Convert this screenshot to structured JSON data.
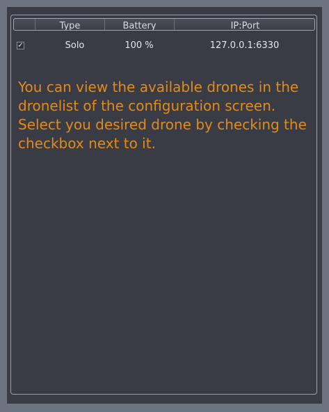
{
  "table": {
    "columns": [
      "",
      "Type",
      "Battery",
      "IP:Port"
    ],
    "rows": [
      {
        "selected": true,
        "check_mark": "✓",
        "type": "Solo",
        "battery": "100 %",
        "ip_port": "127.0.0.1:6330"
      }
    ]
  },
  "instructions": "You can view the available drones in the dronelist of the configuration screen. Select you desired drone by checking the checkbox next to it.",
  "colors": {
    "background": "#6b7480",
    "window": "#393c45",
    "text": "#e4e6e9",
    "instruction_text": "#e48a16"
  }
}
